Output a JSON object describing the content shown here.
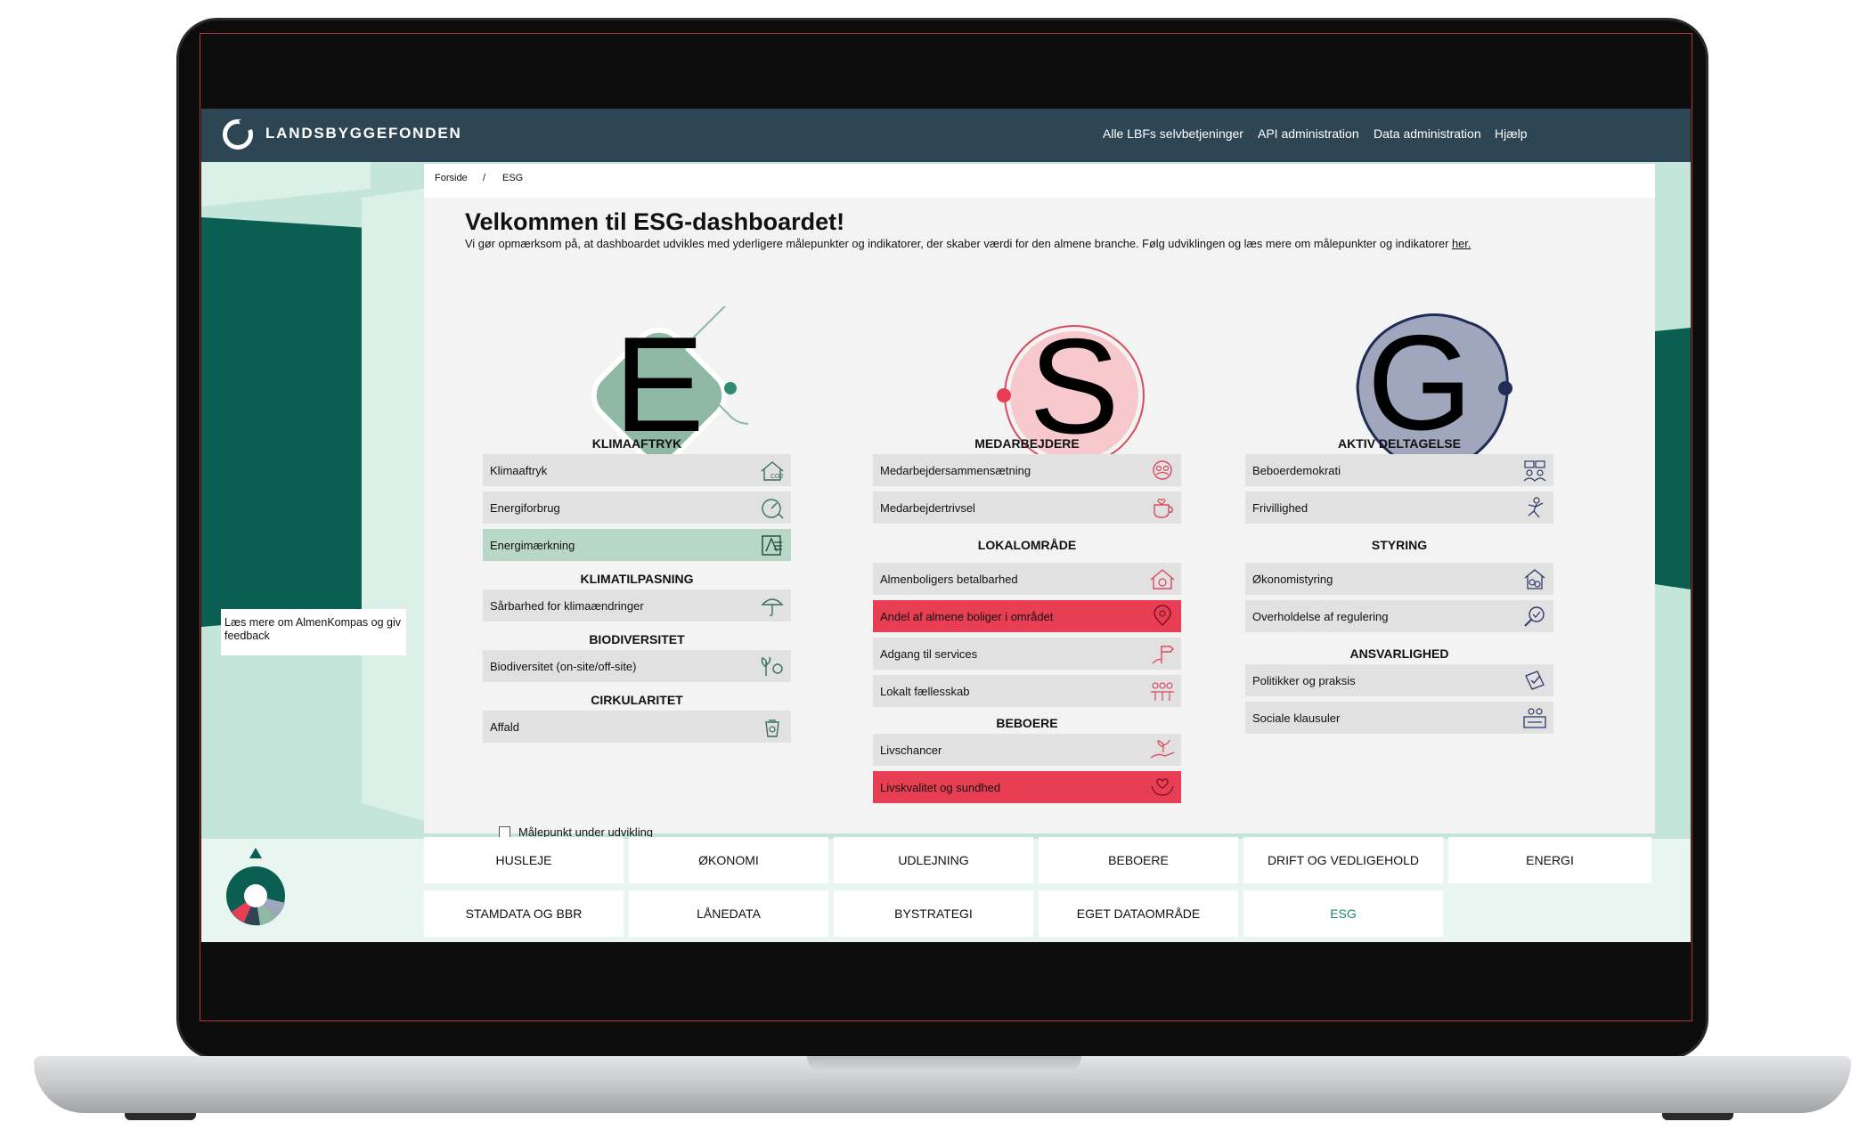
{
  "header": {
    "brand": "LANDSBYGGEFONDEN",
    "nav": [
      "Alle LBFs selvbetjeninger",
      "API administration",
      "Data administration",
      "Hjælp"
    ]
  },
  "breadcrumb": [
    "Forside",
    "/",
    "ESG"
  ],
  "page": {
    "title": "Velkommen til ESG-dashboardet!",
    "intro": "Vi gør opmærksom på, at dashboardet udvikles med yderligere målepunkter og indikatorer, der skaber værdi for den almene branche. Følg udviklingen og læs mere om målepunkter og indikatorer ",
    "intro_link": "her."
  },
  "feedback": "Læs mere om AlmenKompas og giv feedback",
  "columns": {
    "e": {
      "letter": "E",
      "color": "#8fb9a5",
      "sections": [
        {
          "title": "KLIMAAFTRYK",
          "items": [
            "Klimaaftryk",
            "Energiforbrug",
            "Energimærkning"
          ]
        },
        {
          "title": "KLIMATILPASNING",
          "items": [
            "Sårbarhed for klimaændringer"
          ]
        },
        {
          "title": "BIODIVERSITET",
          "items": [
            "Biodiversitet (on-site/off-site)"
          ]
        },
        {
          "title": "CIRKULARITET",
          "items": [
            "Affald"
          ]
        }
      ]
    },
    "s": {
      "letter": "S",
      "color": "#f7c8cc",
      "sections": [
        {
          "title": "MEDARBEJDERE",
          "items": [
            "Medarbejdersammensætning",
            "Medarbejdertrivsel"
          ]
        },
        {
          "title": "LOKALOMRÅDE",
          "items": [
            "Almenboligers betalbarhed",
            "Andel af almene boliger i området",
            "Adgang til services",
            "Lokalt fællesskab"
          ]
        },
        {
          "title": "BEBOERE",
          "items": [
            "Livschancer",
            "Livskvalitet og sundhed"
          ]
        }
      ]
    },
    "g": {
      "letter": "G",
      "color": "#a0a7bd",
      "sections": [
        {
          "title": "AKTIV DELTAGELSE",
          "items": [
            "Beboerdemokrati",
            "Frivillighed"
          ]
        },
        {
          "title": "STYRING",
          "items": [
            "Økonomistyring",
            "Overholdelse af regulering"
          ]
        },
        {
          "title": "ANSVARLIGHED",
          "items": [
            "Politikker og praksis",
            "Sociale klausuler"
          ]
        }
      ]
    }
  },
  "legend": "Målepunkt under udvikling",
  "tabs_row1": [
    "HUSLEJE",
    "ØKONOMI",
    "UDLEJNING",
    "BEBOERE",
    "DRIFT OG VEDLIGEHOLD",
    "ENERGI"
  ],
  "tabs_row2": [
    "STAMDATA OG BBR",
    "LÅNEDATA",
    "BYSTRATEGI",
    "EGET DATAOMRÅDE",
    "ESG"
  ],
  "colors": {
    "header": "#2e4654",
    "dark_green": "#0b5e52",
    "highlight_green": "#b9d7c5",
    "highlight_red": "#e83e54",
    "active_tab": "#1d8a6b"
  }
}
